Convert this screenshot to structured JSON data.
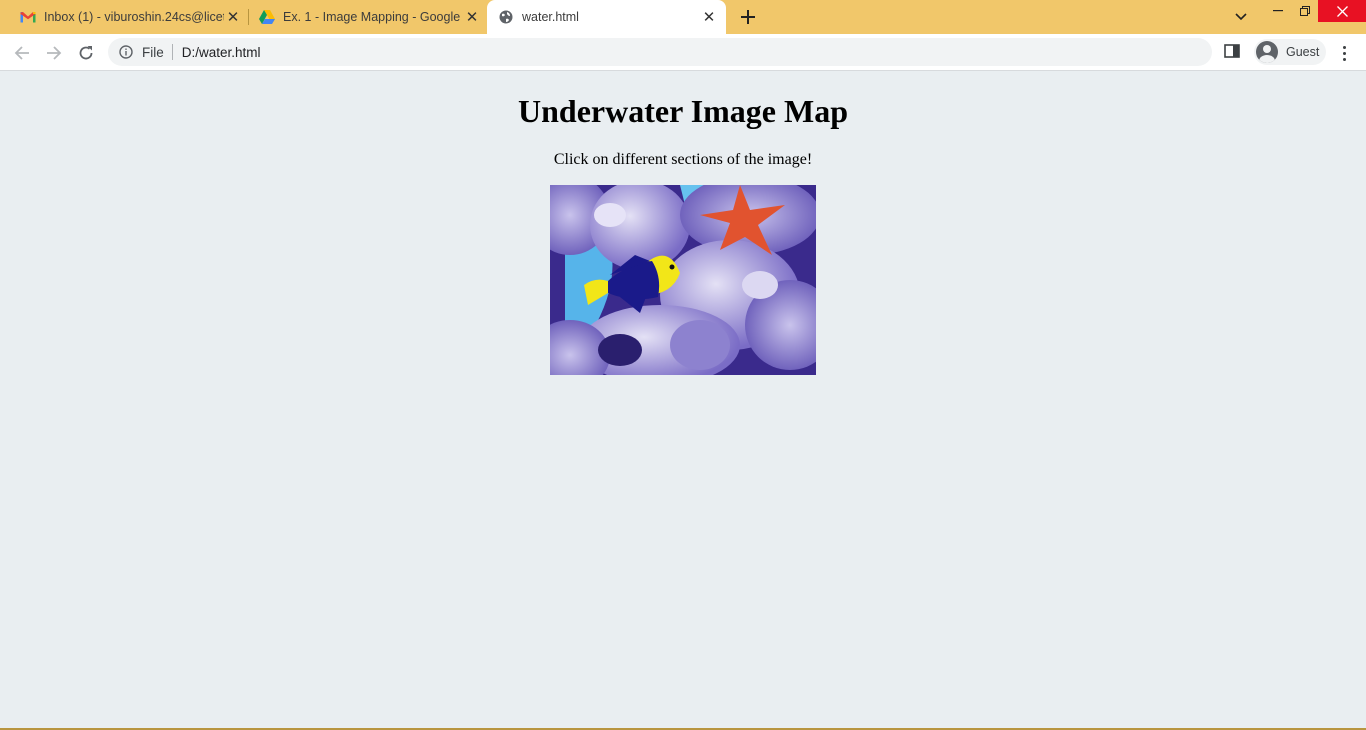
{
  "browser": {
    "tabs": [
      {
        "title": "Inbox (1) - viburoshin.24cs@licet",
        "favicon": "gmail-icon"
      },
      {
        "title": "Ex. 1 - Image Mapping - Google",
        "favicon": "google-drive-icon"
      },
      {
        "title": "water.html",
        "favicon": "globe-icon",
        "active": true
      }
    ],
    "address": {
      "scheme_label": "File",
      "url": "D:/water.html"
    },
    "profile_label": "Guest",
    "colors": {
      "tabstrip": "#f1c76a",
      "close": "#e81123",
      "page_bg": "#e9eef1"
    }
  },
  "page": {
    "heading": "Underwater Image Map",
    "subtext": "Click on different sections of the image!",
    "image": {
      "alt": "underwater reef with fish and starfish",
      "icon": "underwater-image"
    }
  }
}
